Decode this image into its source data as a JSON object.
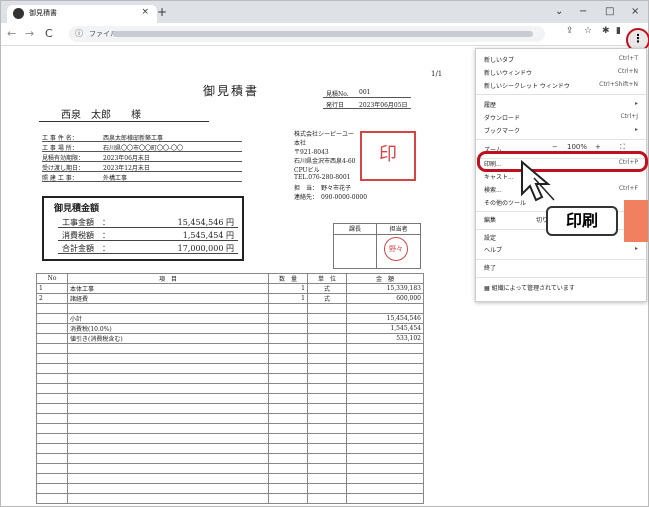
{
  "browser": {
    "tab_title": "御見積書",
    "tab_close": "×",
    "new_tab": "+",
    "win_min": "−",
    "win_max": "□",
    "win_close": "×",
    "win_chevron": "⌄",
    "address_prefix": "ファイル",
    "kebab": "⋮"
  },
  "document": {
    "page_no": "1/1",
    "title": "御見積書",
    "customer": "西泉　太郎　　様",
    "estimate_no_label": "見積No.",
    "estimate_no": "001",
    "issue_date_label": "発行日",
    "issue_date": "2023年06月05日",
    "info": [
      {
        "label": "工 事 件 名：",
        "value": "西泉太郎様邸新築工事"
      },
      {
        "label": "工 事 場 所：",
        "value": "石川県〇〇市〇〇町〇〇-〇〇"
      },
      {
        "label": "見積有効期限：",
        "value": "2023年06月末日"
      },
      {
        "label": "受け渡し期日：",
        "value": "2023年12月末日"
      },
      {
        "label": "照 建 工 事：",
        "value": "外構工事"
      }
    ],
    "company": [
      "株式会社シーピーユー",
      "本社",
      "〒921-8043",
      "石川県金沢市西泉4-60",
      "CPUビル",
      "TEL.076-280-8001",
      "担　当：　野々市花子",
      "連絡先：　090-0000-0000"
    ],
    "company_seal": "印",
    "amount_title": "御見積金額",
    "amounts": [
      {
        "label": "工事金額　：",
        "value": "15,454,546 円"
      },
      {
        "label": "消費税額　：",
        "value": "1,545,454 円"
      },
      {
        "label": "合計金額　：",
        "value": "17,000,000 円"
      }
    ],
    "approvals": {
      "left": "課長",
      "right": "担当者",
      "stamp": "野々"
    },
    "table": {
      "headers": [
        "No",
        "項　目",
        "数　量",
        "単　位",
        "金　額"
      ],
      "rows": [
        [
          "1",
          "本体工事",
          "1",
          "式",
          "15,339,183"
        ],
        [
          "2",
          "諸経費",
          "1",
          "式",
          "600,000"
        ],
        [
          "",
          "",
          "",
          "",
          ""
        ],
        [
          "",
          "小計",
          "",
          "",
          "15,454,546"
        ],
        [
          "",
          "消費税(10.0%)",
          "",
          "",
          "1,545,454"
        ],
        [
          "",
          "値引き(消費税含む)",
          "",
          "",
          "533,102"
        ]
      ]
    }
  },
  "menu": {
    "items": [
      {
        "label": "新しいタブ",
        "shortcut": "Ctrl+T"
      },
      {
        "label": "新しいウィンドウ",
        "shortcut": "Ctrl+N"
      },
      {
        "label": "新しいシークレット ウィンドウ",
        "shortcut": "Ctrl+Shift+N"
      },
      {
        "label": "履歴",
        "shortcut": "▸"
      },
      {
        "label": "ダウンロード",
        "shortcut": "Ctrl+J"
      },
      {
        "label": "ブックマーク",
        "shortcut": "▸"
      },
      {
        "label": "ズーム",
        "shortcut": ""
      },
      {
        "label": "印刷...",
        "shortcut": "Ctrl+P"
      },
      {
        "label": "キャスト...",
        "shortcut": ""
      },
      {
        "label": "検索...",
        "shortcut": "Ctrl+F"
      },
      {
        "label": "その他のツール",
        "shortcut": "▸"
      },
      {
        "label": "編集",
        "shortcut": "切り取り"
      },
      {
        "label": "設定",
        "shortcut": ""
      },
      {
        "label": "ヘルプ",
        "shortcut": "▸"
      },
      {
        "label": "終了",
        "shortcut": ""
      },
      {
        "label": "組織によって管理されています",
        "shortcut": ""
      }
    ],
    "zoom_minus": "−",
    "zoom_value": "100%",
    "zoom_plus": "+",
    "fullscreen": "⛶"
  },
  "callout": "印刷"
}
